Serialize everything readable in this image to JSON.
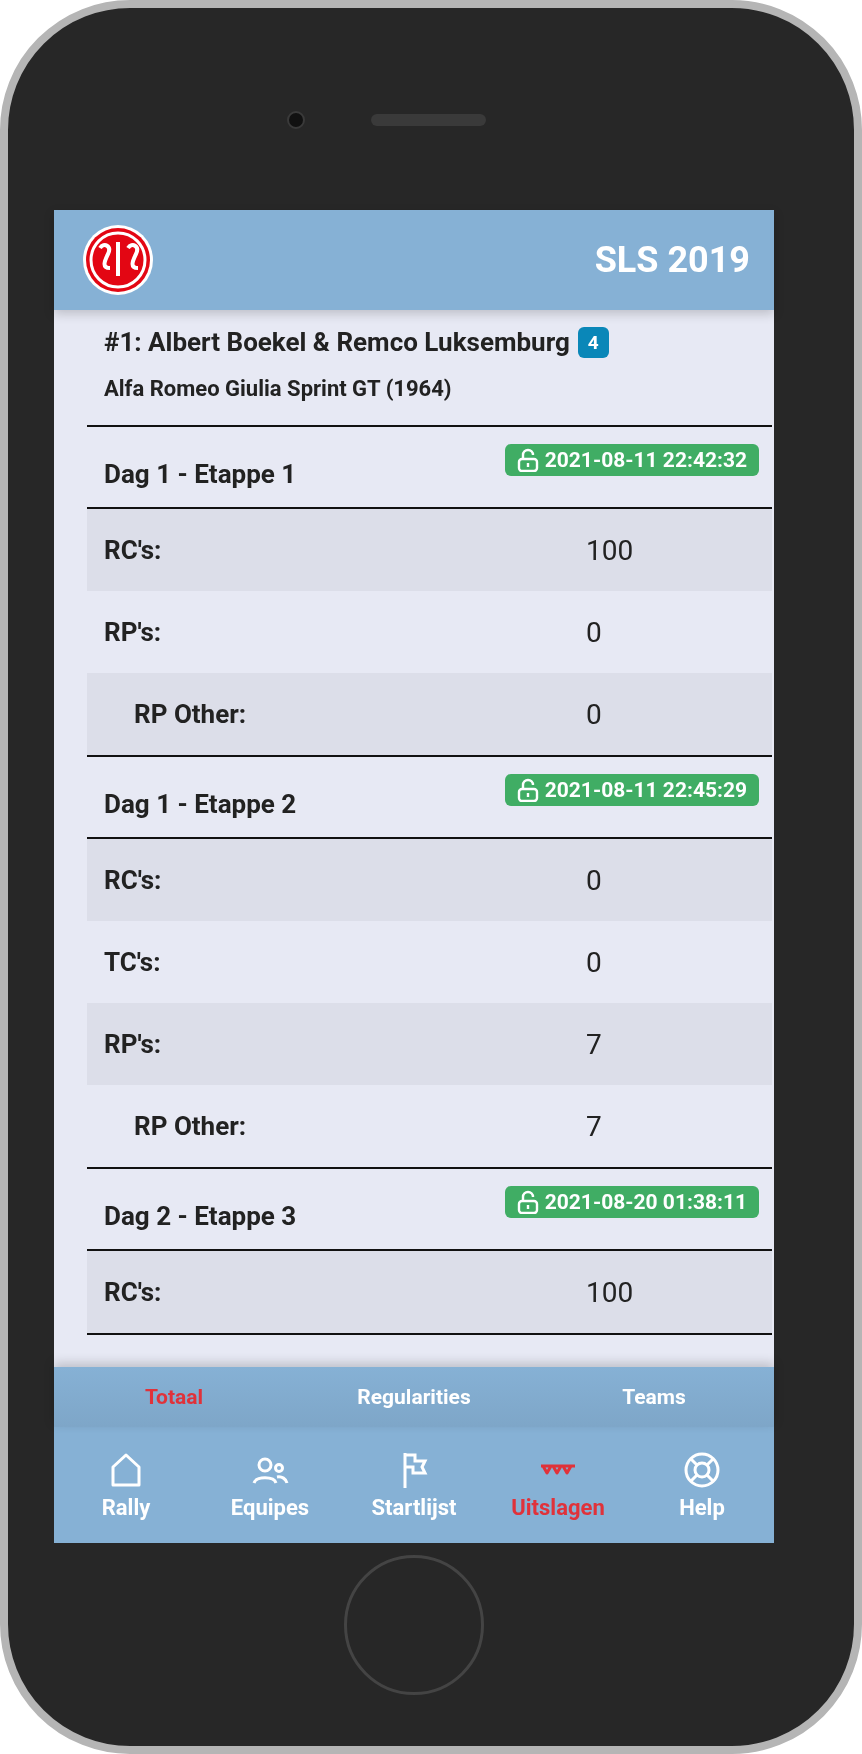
{
  "app": {
    "title": "SLS 2019"
  },
  "crew": {
    "title": "#1: Albert Boekel & Remco Luksemburg",
    "badge": "4",
    "car": "Alfa Romeo Giulia Sprint GT (1964)"
  },
  "stages": [
    {
      "name": "Dag 1 - Etappe 1",
      "timestamp": "2021-08-11 22:42:32",
      "rows": [
        {
          "label": "RC's:",
          "value": "100"
        },
        {
          "label": "RP's:",
          "value": "0",
          "children": [
            {
              "label": "RP Other:",
              "value": "0"
            }
          ]
        }
      ]
    },
    {
      "name": "Dag 1 - Etappe 2",
      "timestamp": "2021-08-11 22:45:29",
      "rows": [
        {
          "label": "RC's:",
          "value": "0"
        },
        {
          "label": "TC's:",
          "value": "0"
        },
        {
          "label": "RP's:",
          "value": "7",
          "children": [
            {
              "label": "RP Other:",
              "value": "7"
            }
          ]
        }
      ]
    },
    {
      "name": "Dag 2 - Etappe 3",
      "timestamp": "2021-08-20 01:38:11",
      "rows": [
        {
          "label": "RC's:",
          "value": "100"
        }
      ]
    }
  ],
  "tabs": [
    {
      "label": "Totaal",
      "selected": true
    },
    {
      "label": "Regularities",
      "selected": false
    },
    {
      "label": "Teams",
      "selected": false
    }
  ],
  "nav": [
    {
      "kind": "home",
      "label": "Rally",
      "selected": false
    },
    {
      "kind": "people",
      "label": "Equipes",
      "selected": false
    },
    {
      "kind": "flag",
      "label": "Startlijst",
      "selected": false
    },
    {
      "kind": "bunting",
      "label": "Uitslagen",
      "selected": true
    },
    {
      "kind": "lifebuoy",
      "label": "Help",
      "selected": false
    }
  ]
}
